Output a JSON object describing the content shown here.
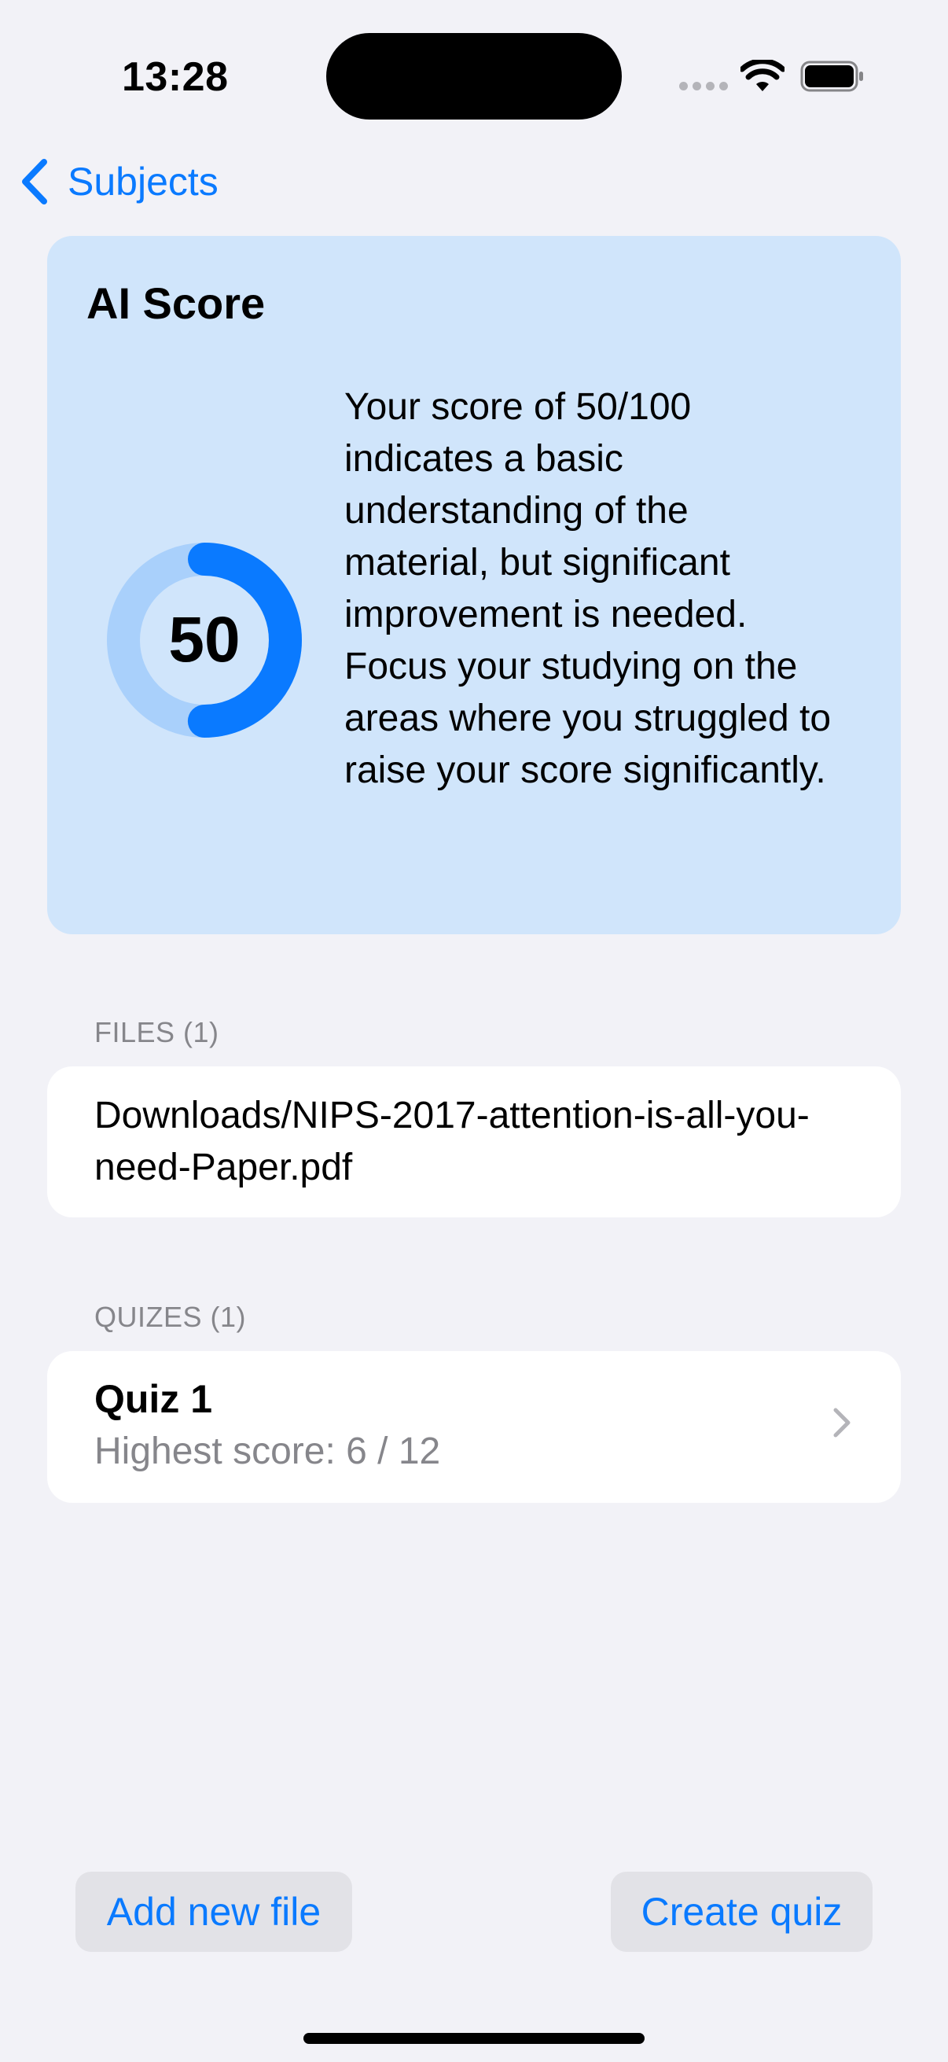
{
  "status_bar": {
    "time": "13:28"
  },
  "nav": {
    "back_label": "Subjects"
  },
  "score_card": {
    "title": "AI Score",
    "score": "50",
    "score_fraction": 0.5,
    "description": "Your score of 50/100 indicates a basic understanding of the material, but significant improvement is needed. Focus your studying on the areas where you struggled to raise your score significantly.",
    "colors": {
      "card": "#d0e5fb",
      "ring_fill": "#0a7aff",
      "ring_track": "#a9d0fb"
    }
  },
  "files": {
    "header": "FILES (1)",
    "items": [
      {
        "name": "Downloads/NIPS-2017-attention-is-all-you-need-Paper.pdf"
      }
    ]
  },
  "quizzes": {
    "header": "QUIZES (1)",
    "items": [
      {
        "title": "Quiz 1",
        "subtitle": "Highest score: 6 / 12"
      }
    ]
  },
  "actions": {
    "add_file_label": "Add new file",
    "create_quiz_label": "Create quiz"
  },
  "accent_color": "#0a7aff"
}
